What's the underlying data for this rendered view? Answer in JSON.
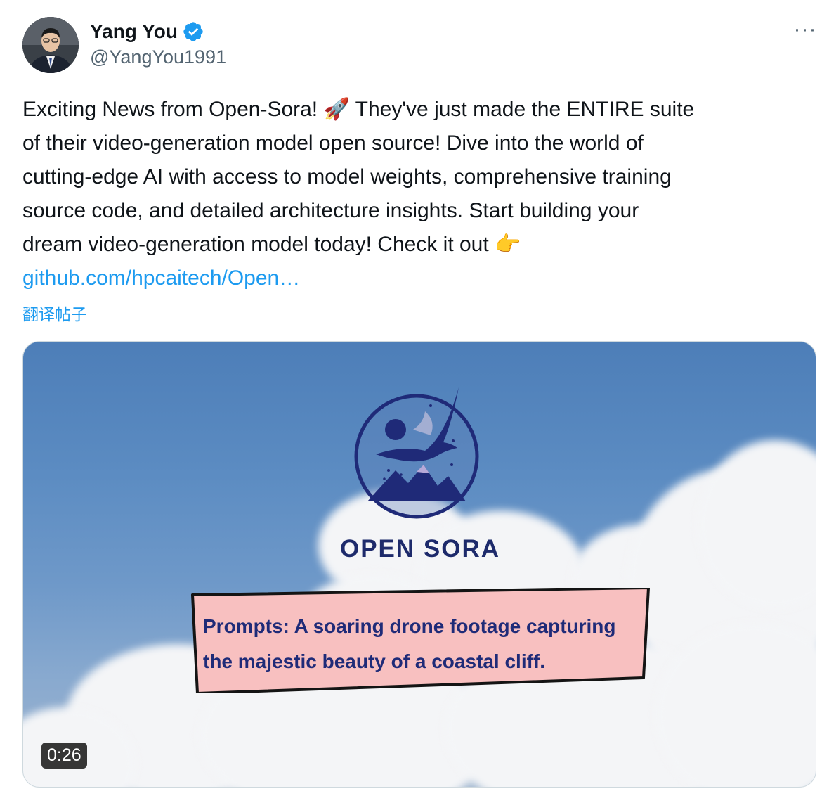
{
  "author": {
    "display_name": "Yang You",
    "handle": "@YangYou1991",
    "avatar_icon": "person-avatar",
    "verified_icon": "verified-badge-icon",
    "verified_color": "#1d9bf0"
  },
  "more_icon": "ellipsis-icon",
  "tweet": {
    "lines": [
      "Exciting News from Open-Sora! 🚀 They've just made the ENTIRE suite",
      "of their video-generation model open source! Dive into the world of",
      "cutting-edge AI with access to model weights, comprehensive training",
      "source code, and detailed architecture insights. Start building your",
      "dream video-generation model today! Check it out 👉"
    ],
    "link_text": "github.com/hpcaitech/Open…",
    "translate_label": "翻译帖子"
  },
  "media": {
    "brand": "OPEN SORA",
    "prompt_lines": [
      "Prompts: A soaring drone footage capturing",
      "the majestic beauty of a coastal cliff."
    ],
    "duration": "0:26",
    "brand_color": "#1d2a6b",
    "prompt_bg": "#f8c0c0"
  }
}
